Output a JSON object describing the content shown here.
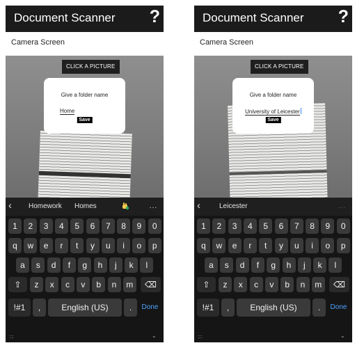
{
  "app": {
    "title": "Document Scanner",
    "help_label": "?"
  },
  "screen_label": "Camera Screen",
  "capture_button": "CLICK A PICTURE",
  "dialog": {
    "title": "Give a folder name",
    "save_label": "Save"
  },
  "left": {
    "folder_value": "Home",
    "suggestions": [
      "Homework",
      "Homes"
    ]
  },
  "right": {
    "folder_value": "University of Leicester",
    "suggestions": [
      "Leicester"
    ]
  },
  "keyboard": {
    "more": "…",
    "row1": [
      "1",
      "2",
      "3",
      "4",
      "5",
      "6",
      "7",
      "8",
      "9",
      "0"
    ],
    "row2": [
      "q",
      "w",
      "e",
      "r",
      "t",
      "y",
      "u",
      "i",
      "o",
      "p"
    ],
    "row3": [
      "a",
      "s",
      "d",
      "f",
      "g",
      "h",
      "j",
      "k",
      "l"
    ],
    "row4": [
      "z",
      "x",
      "c",
      "v",
      "b",
      "n",
      "m"
    ],
    "symbols": "!#1",
    "comma": ",",
    "space": "English (US)",
    "period": ".",
    "done": "Done",
    "back_icon": "‹",
    "shift_icon": "⇧",
    "backspace_icon": "⌫",
    "hide_icon": "⌄",
    "grid_icon": "∷"
  }
}
